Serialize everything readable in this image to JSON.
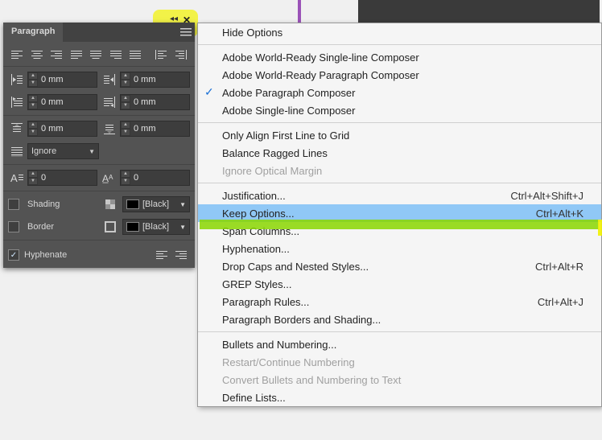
{
  "panel": {
    "title": "Paragraph",
    "indent_left": "0 mm",
    "indent_right": "0 mm",
    "first_line": "0 mm",
    "last_line": "0 mm",
    "space_before": "0 mm",
    "space_after": "0 mm",
    "align_grid": "Ignore",
    "dropcap_lines": "0",
    "dropcap_chars": "0",
    "shading_label": "Shading",
    "shading_color": "[Black]",
    "border_label": "Border",
    "border_color": "[Black]",
    "hyphenate_label": "Hyphenate",
    "hyphenate_checked": true
  },
  "menu": {
    "items": [
      {
        "label": "Hide Options",
        "type": "item"
      },
      {
        "type": "sep"
      },
      {
        "label": "Adobe World-Ready Single-line Composer",
        "type": "item"
      },
      {
        "label": "Adobe World-Ready Paragraph Composer",
        "type": "item"
      },
      {
        "label": "Adobe Paragraph Composer",
        "type": "item",
        "checked": true
      },
      {
        "label": "Adobe Single-line Composer",
        "type": "item"
      },
      {
        "type": "sep"
      },
      {
        "label": "Only Align First Line to Grid",
        "type": "item"
      },
      {
        "label": "Balance Ragged Lines",
        "type": "item"
      },
      {
        "label": "Ignore Optical Margin",
        "type": "disabled"
      },
      {
        "type": "sep"
      },
      {
        "label": "Justification...",
        "shortcut": "Ctrl+Alt+Shift+J",
        "type": "item"
      },
      {
        "label": "Keep Options...",
        "shortcut": "Ctrl+Alt+K",
        "type": "item",
        "selected": true
      },
      {
        "label": "Span Columns...",
        "type": "item"
      },
      {
        "label": "Hyphenation...",
        "type": "item"
      },
      {
        "label": "Drop Caps and Nested Styles...",
        "shortcut": "Ctrl+Alt+R",
        "type": "item"
      },
      {
        "label": "GREP Styles...",
        "type": "item"
      },
      {
        "label": "Paragraph Rules...",
        "shortcut": "Ctrl+Alt+J",
        "type": "item"
      },
      {
        "label": "Paragraph Borders and Shading...",
        "type": "item"
      },
      {
        "type": "sep"
      },
      {
        "label": "Bullets and Numbering...",
        "type": "item"
      },
      {
        "label": "Restart/Continue Numbering",
        "type": "disabled"
      },
      {
        "label": "Convert Bullets and Numbering to Text",
        "type": "disabled"
      },
      {
        "label": "Define Lists...",
        "type": "item"
      }
    ]
  }
}
